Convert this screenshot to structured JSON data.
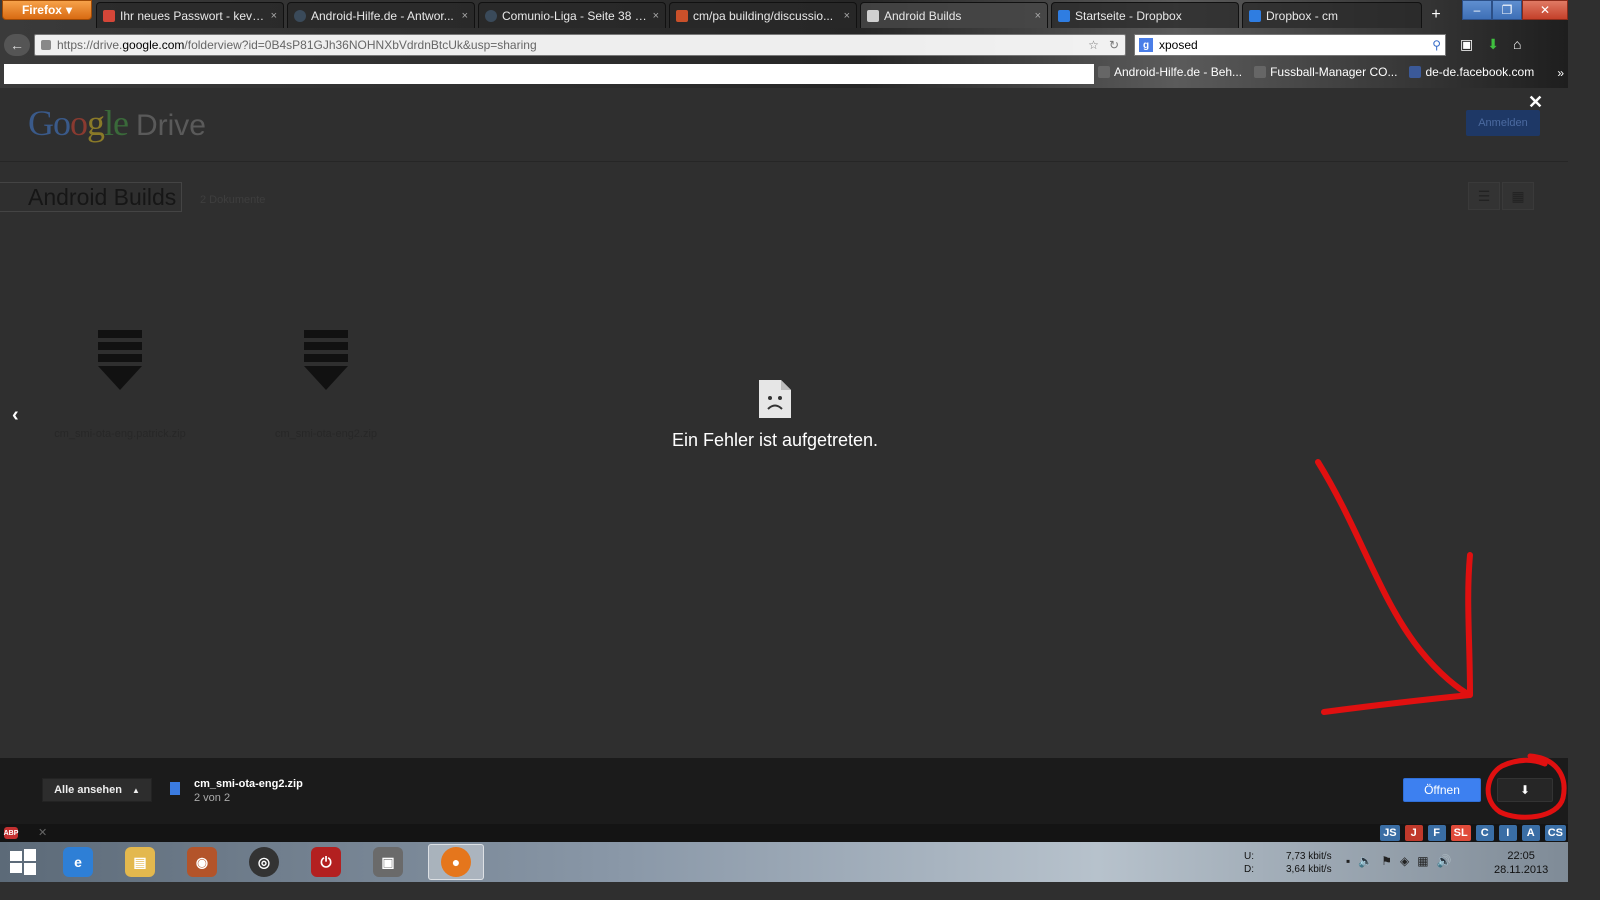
{
  "browser": {
    "menu_label": "Firefox",
    "tabs": [
      {
        "title": "Ihr neues Passwort - kevin...",
        "icon": "gmail-icon",
        "color": "#d44638"
      },
      {
        "title": "Android-Hilfe.de - Antwor...",
        "icon": "android-hilfe-icon",
        "color": "#3a4a5a"
      },
      {
        "title": "Comunio-Liga - Seite 38 - ...",
        "icon": "comunio-icon",
        "color": "#3a4a5a"
      },
      {
        "title": "cm/pa building/discussio...",
        "icon": "xda-icon",
        "color": "#c9502a"
      },
      {
        "title": "Android Builds",
        "icon": "drive-icon",
        "color": "#cfcfcf"
      },
      {
        "title": "Startseite - Dropbox",
        "icon": "dropbox-icon",
        "color": "#2f7de1"
      },
      {
        "title": "Dropbox - cm",
        "icon": "dropbox-icon",
        "color": "#2f7de1"
      }
    ],
    "new_tab_label": "+",
    "url": {
      "prefix": "https://drive.",
      "host": "google.com",
      "path": "/folderview?id=0B4sP81GJh36NOHNXbVdrdnBtcUk&usp=sharing"
    },
    "search_value": "xposed",
    "bookmarks": [
      "Android-Hilfe.de - Beh...",
      "Fussball-Manager CO...",
      "de-de.facebook.com"
    ]
  },
  "drive": {
    "logo": {
      "g1": "Go",
      "g2": "o",
      "g3": "g",
      "g4": "le",
      "product": "Drive"
    },
    "close_glyph": "✕",
    "signin_label": "Anmelden",
    "folder_title": "Android Builds",
    "folder_count": "2 Dokumente",
    "files": [
      {
        "name": "cm_smi-ota-eng.patrick.zip"
      },
      {
        "name": "cm_smi-ota-eng2.zip"
      }
    ],
    "prev_glyph": "‹",
    "error_message": "Ein Fehler ist aufgetreten."
  },
  "viewer_bar": {
    "view_all_label": "Alle ansehen",
    "current_file": "cm_smi-ota-eng2.zip",
    "position": "2 von 2",
    "open_label": "Öffnen",
    "download_glyph": "⬇"
  },
  "statusbar": {
    "addon_badges": [
      {
        "label": "JS",
        "color": "#3a6ea5"
      },
      {
        "label": "J",
        "color": "#c0392b"
      },
      {
        "label": "F",
        "color": "#3a6ea5"
      },
      {
        "label": "SL",
        "color": "#e04b3a"
      },
      {
        "label": "C",
        "color": "#3a6ea5"
      },
      {
        "label": "I",
        "color": "#3a6ea5"
      },
      {
        "label": "A",
        "color": "#3a6ea5"
      },
      {
        "label": "CS",
        "color": "#3a6ea5"
      }
    ]
  },
  "taskbar": {
    "upload_label": "U:",
    "download_label": "D:",
    "upload_rate": "7,73 kbit/s",
    "download_rate": "3,64 kbit/s",
    "time": "22:05",
    "date": "28.11.2013"
  },
  "annotation_color": "#e01010"
}
